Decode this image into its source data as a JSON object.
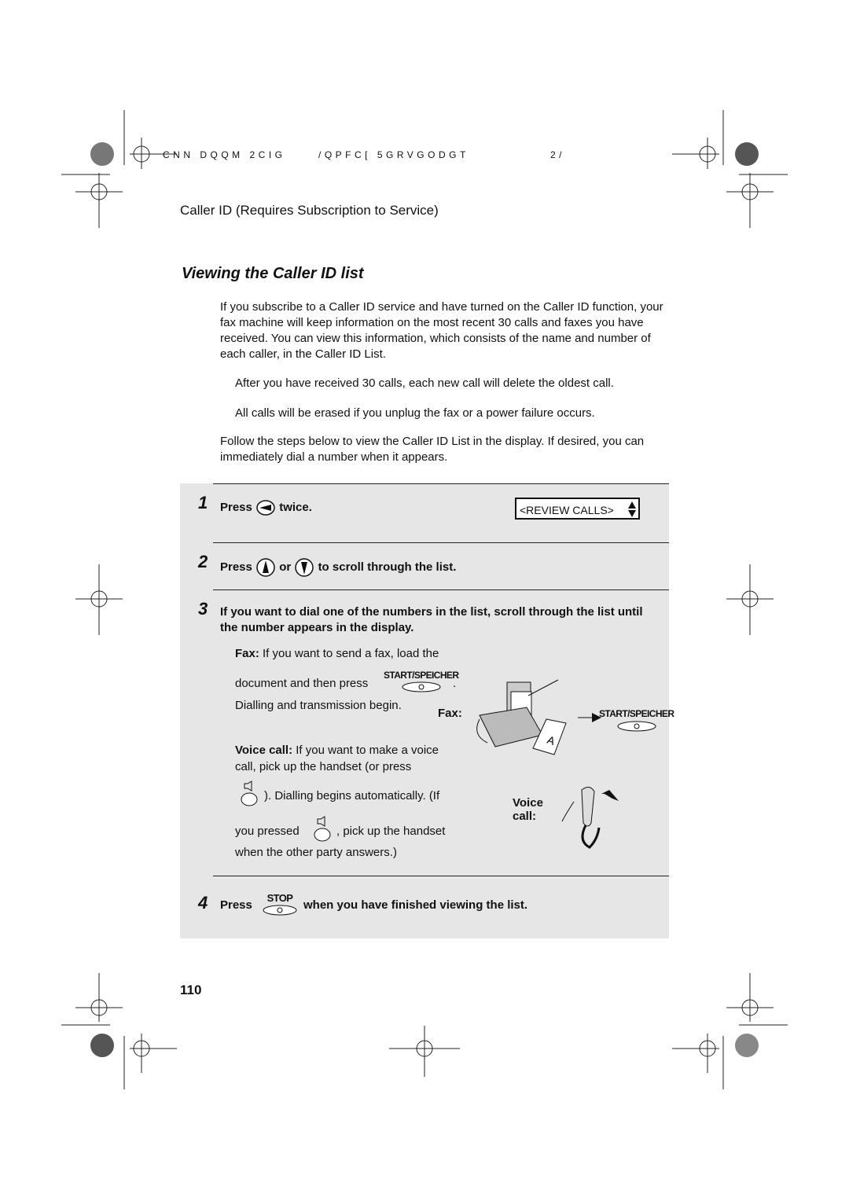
{
  "header": {
    "left": "CNN DQQM 2CIG",
    "middle": "/QPFC[ 5GRVGODGT",
    "right": "2/"
  },
  "section_title": "Caller ID (Requires Subscription to Service)",
  "heading": "Viewing the Caller ID list",
  "intro": "If you subscribe to a Caller ID service and have turned on the Caller ID function, your fax machine will keep information on the most recent 30 calls and faxes you have received. You can view this information, which consists of the name and number of each caller, in the Caller ID List.",
  "notes": [
    "After you have received 30 calls, each new call will delete the oldest call.",
    "All calls will be erased if you unplug the fax or a power failure occurs."
  ],
  "follow": "Follow the steps below to view the Caller ID List in the display. If desired, you can immediately dial a number when it appears.",
  "steps": [
    {
      "number": "1",
      "press": "Press",
      "after": "twice.",
      "display": "<REVIEW CALLS>"
    },
    {
      "number": "2",
      "press": "Press",
      "or": "or",
      "after": "to  scroll through the list."
    },
    {
      "number": "3",
      "text": "If you want to dial one of the numbers in the list, scroll through the list until the number appears in the display.",
      "fax_label": "Fax:",
      "fax_text": "If you want to send a fax, load the",
      "fax_text2": "document and then press",
      "fax_text3": "Dialling and transmission begin.",
      "voice_label": "Voice call:",
      "voice_text": "If you want to make a voice",
      "voice_text2": "call, pick up the handset (or press",
      "voice_text3": "). Dialling begins automatically. (If",
      "voice_text4": "you pressed",
      "voice_text5": ", pick up the handset",
      "voice_text6": "when the other party answers.)",
      "illus_fax": "Fax:",
      "illus_voice": "Voice call:",
      "start_key": "START/SPEICHER"
    },
    {
      "number": "4",
      "press": "Press",
      "stop_key": "STOP",
      "after": "when you have finished viewing the list."
    }
  ],
  "page_number": "110"
}
